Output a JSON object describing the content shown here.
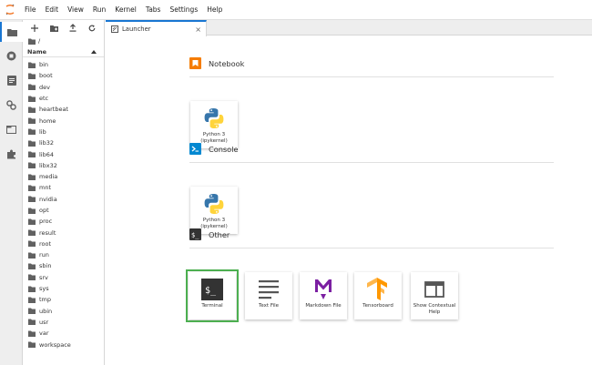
{
  "menubar": {
    "items": [
      "File",
      "Edit",
      "View",
      "Run",
      "Kernel",
      "Tabs",
      "Settings",
      "Help"
    ]
  },
  "filebrowser": {
    "breadcrumb": "/",
    "column_name": "Name",
    "items": [
      "bin",
      "boot",
      "dev",
      "etc",
      "heartbeat",
      "home",
      "lib",
      "lib32",
      "lib64",
      "libx32",
      "media",
      "mnt",
      "nvidia",
      "opt",
      "proc",
      "result",
      "root",
      "run",
      "sbin",
      "srv",
      "sys",
      "tmp",
      "ubin",
      "usr",
      "var",
      "workspace"
    ]
  },
  "tab": {
    "label": "Launcher",
    "close": "×"
  },
  "launcher": {
    "sections": {
      "notebook": "Notebook",
      "console": "Console",
      "other": "Other"
    },
    "notebook_card": "Python 3 (ipykernel)",
    "console_card": "Python 3 (ipykernel)",
    "other_cards": [
      "Terminal",
      "Text File",
      "Markdown File",
      "Tensorboard",
      "Show Contextual Help"
    ]
  },
  "colors": {
    "accent": "#1976d2",
    "notebook_orange": "#f57c00",
    "console_blue": "#0288d1",
    "terminal_green_highlight": "#4caf50",
    "markdown_purple": "#7b1fa2",
    "tensorboard_orange": "#ff9800"
  }
}
